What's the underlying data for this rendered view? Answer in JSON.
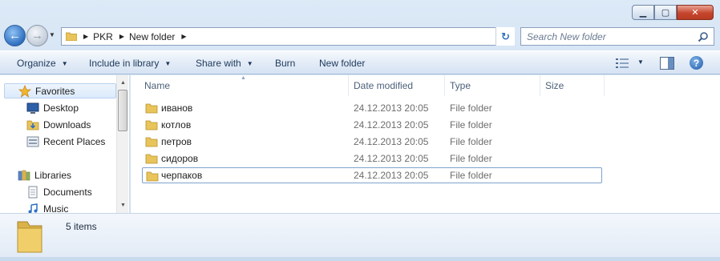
{
  "window": {
    "minimize_glyph": "▁",
    "maximize_glyph": "▢",
    "close_glyph": "✕"
  },
  "nav": {
    "back_glyph": "←",
    "forward_glyph": "→"
  },
  "address": {
    "breadcrumb": [
      "PKR",
      "New folder"
    ],
    "refresh_glyph": "↻"
  },
  "search": {
    "placeholder": "Search New folder"
  },
  "commands": {
    "organize": "Organize",
    "include_in_library": "Include in library",
    "share_with": "Share with",
    "burn": "Burn",
    "new_folder": "New folder",
    "help": "?"
  },
  "navpane": {
    "favorites": "Favorites",
    "desktop": "Desktop",
    "downloads": "Downloads",
    "recent_places": "Recent Places",
    "libraries": "Libraries",
    "documents": "Documents",
    "music": "Music"
  },
  "columns": {
    "name": "Name",
    "date_modified": "Date modified",
    "type": "Type",
    "size": "Size"
  },
  "files": [
    {
      "name": "иванов",
      "date": "24.12.2013 20:05",
      "type": "File folder"
    },
    {
      "name": "котлов",
      "date": "24.12.2013 20:05",
      "type": "File folder"
    },
    {
      "name": "петров",
      "date": "24.12.2013 20:05",
      "type": "File folder"
    },
    {
      "name": "сидоров",
      "date": "24.12.2013 20:05",
      "type": "File folder"
    },
    {
      "name": "черпаков",
      "date": "24.12.2013 20:05",
      "type": "File folder"
    }
  ],
  "details": {
    "item_count": "5 items"
  },
  "colors": {
    "folder": "#e8c45a",
    "accent": "#2f6fc0"
  },
  "icons": {
    "folder": "folder-icon",
    "favorites": "star-icon",
    "desktop": "desktop-icon",
    "downloads": "downloads-folder-icon",
    "recent_places": "recent-places-icon",
    "libraries": "libraries-icon",
    "documents": "documents-icon",
    "music": "music-icon"
  }
}
